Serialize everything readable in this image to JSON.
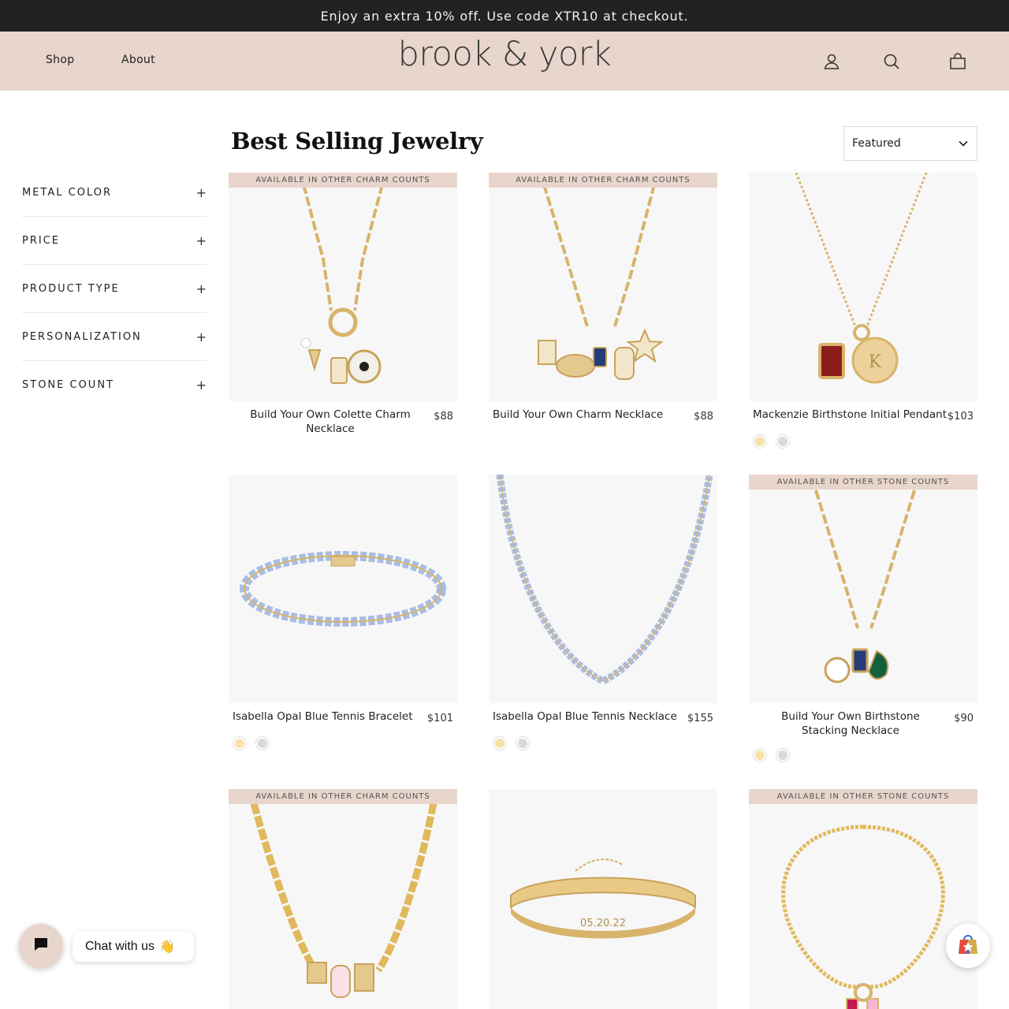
{
  "announcement": "Enjoy an extra 10% off. Use code XTR10 at checkout.",
  "header": {
    "nav": [
      "Shop",
      "About"
    ],
    "logo": "brook & york",
    "icons": [
      "account-icon",
      "search-icon",
      "cart-icon"
    ]
  },
  "page": {
    "title": "Best Selling Jewelry"
  },
  "sort": {
    "selected": "Featured"
  },
  "filters": [
    "METAL COLOR",
    "PRICE",
    "PRODUCT TYPE",
    "PERSONALIZATION",
    "STONE COUNT"
  ],
  "products": [
    {
      "name": "Build Your Own Colette Charm Necklace",
      "price": "$88",
      "banner": "AVAILABLE IN OTHER CHARM COUNTS",
      "swatches": []
    },
    {
      "name": "Build Your Own Charm Necklace",
      "price": "$88",
      "banner": "AVAILABLE IN OTHER CHARM COUNTS",
      "swatches": []
    },
    {
      "name": "Mackenzie Birthstone Initial Pendant",
      "price": "$103",
      "banner": "",
      "swatches": [
        "gold",
        "silver"
      ]
    },
    {
      "name": "Isabella Opal Blue Tennis Bracelet",
      "price": "$101",
      "banner": "",
      "swatches": [
        "gold",
        "silver"
      ]
    },
    {
      "name": "Isabella Opal Blue Tennis Necklace",
      "price": "$155",
      "banner": "",
      "swatches": [
        "gold",
        "silver"
      ]
    },
    {
      "name": "Build Your Own Birthstone Stacking Necklace",
      "price": "$90",
      "banner": "AVAILABLE IN OTHER STONE COUNTS",
      "swatches": [
        "gold",
        "silver"
      ]
    },
    {
      "name": "",
      "price": "",
      "banner": "AVAILABLE IN OTHER CHARM COUNTS",
      "swatches": []
    },
    {
      "name": "",
      "price": "",
      "banner": "",
      "swatches": [],
      "engraving": "05.20.22"
    },
    {
      "name": "",
      "price": "",
      "banner": "AVAILABLE IN OTHER STONE COUNTS",
      "swatches": []
    }
  ],
  "chat": {
    "label": "Chat with us",
    "emoji": "👋"
  },
  "colors": {
    "announcement_bg": "#222222",
    "header_bg": "#e8d5cb",
    "gold_swatch": "#f7e2a6",
    "silver_swatch": "#d9d9d9"
  }
}
